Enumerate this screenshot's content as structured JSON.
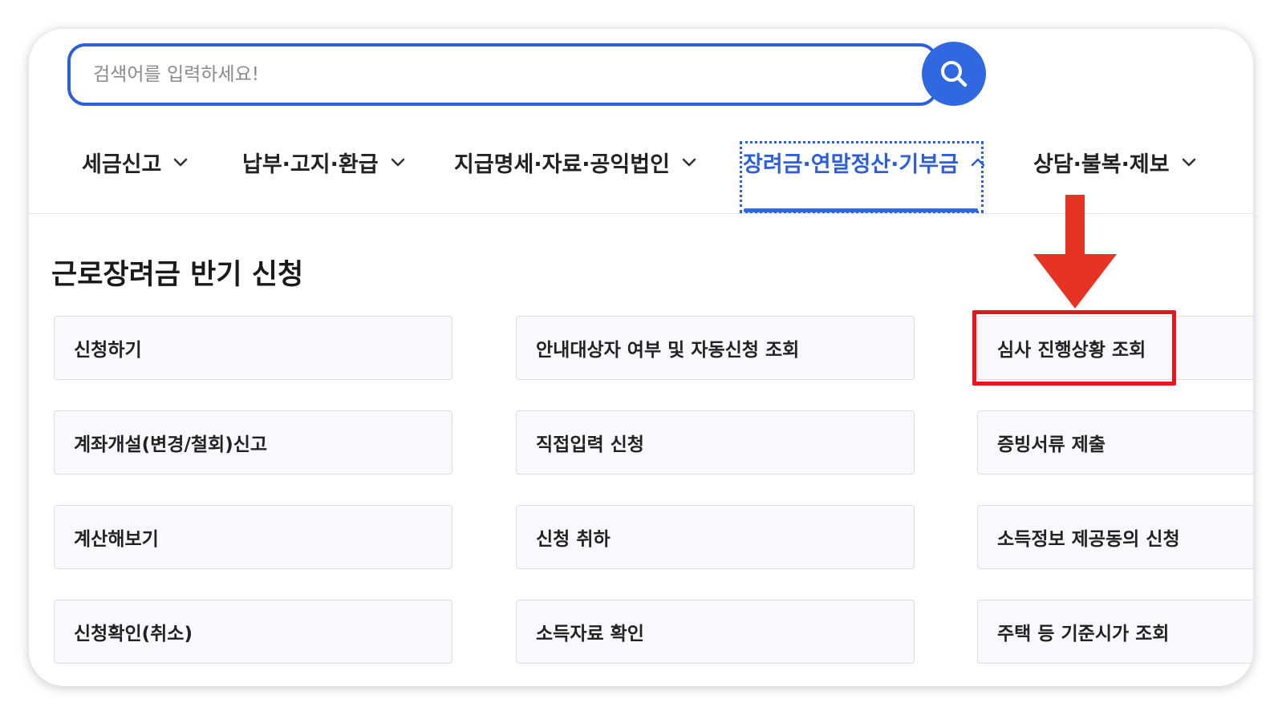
{
  "search": {
    "placeholder": "검색어를 입력하세요!",
    "button_icon": "search-icon"
  },
  "nav": {
    "items": [
      {
        "label": "세금신고",
        "icon": "chevron-down-icon"
      },
      {
        "label": "납부·고지·환급",
        "icon": "chevron-down-icon"
      },
      {
        "label": "지급명세·자료·공익법인",
        "icon": "chevron-down-icon"
      },
      {
        "label": "장려금·연말정산·기부금",
        "icon": "chevron-up-icon",
        "active": true
      },
      {
        "label": "상담·불복·제보",
        "icon": "chevron-down-icon"
      }
    ]
  },
  "section": {
    "title": "근로장려금 반기 신청"
  },
  "menu": [
    [
      "신청하기",
      "안내대상자 여부 및 자동신청 조회",
      "심사 진행상황 조회"
    ],
    [
      "계좌개설(변경/철회)신고",
      "직접입력 신청",
      "증빙서류 제출"
    ],
    [
      "계산해보기",
      "신청 취하",
      "소득정보 제공동의 신청"
    ],
    [
      "신청확인(취소)",
      "소득자료 확인",
      "주택 등 기준시가 조회"
    ]
  ],
  "annotation": {
    "highlighted_item": "심사 진행상황 조회",
    "highlight_color": "#e8141e",
    "arrow_color": "#e63323"
  },
  "colors": {
    "accent": "#2f68e0",
    "active_text": "#2f5fd6",
    "text": "#222222",
    "button_bg": "#f7f9fc",
    "button_border": "#d9dee7"
  }
}
